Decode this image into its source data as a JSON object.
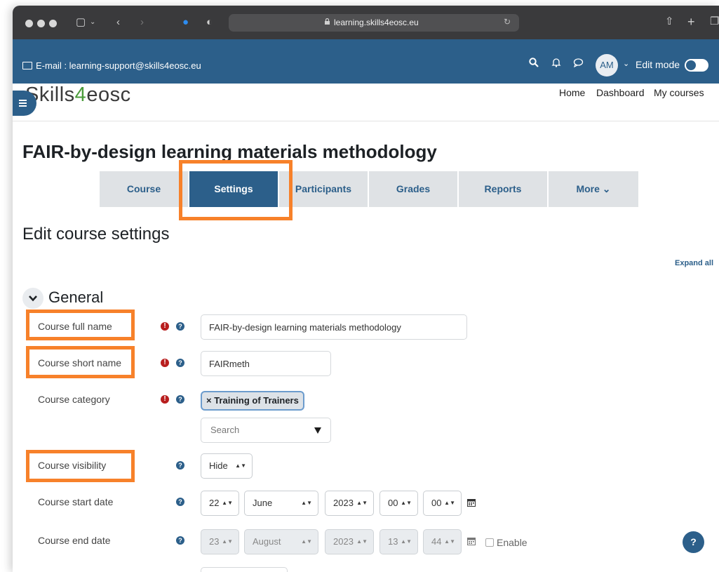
{
  "browser": {
    "url": "learning.skills4eosc.eu"
  },
  "topnav": {
    "email": "E-mail : learning-support@skills4eosc.eu",
    "avatar": "AM",
    "edit_mode": "Edit mode",
    "edit_mode_on": false
  },
  "logo": {
    "part1": "Skills",
    "part2": "4",
    "part3": "eosc"
  },
  "sitenav": {
    "home": "Home",
    "dashboard": "Dashboard",
    "my_courses": "My courses"
  },
  "page": {
    "title": "FAIR-by-design learning materials methodology",
    "section_title": "Edit course settings",
    "expand_all": "Expand all",
    "general": "General"
  },
  "tabs": [
    {
      "label": "Course"
    },
    {
      "label": "Settings",
      "active": true
    },
    {
      "label": "Participants"
    },
    {
      "label": "Grades"
    },
    {
      "label": "Reports"
    },
    {
      "label": "More ⌄"
    }
  ],
  "form": {
    "full_name": {
      "label": "Course full name",
      "value": "FAIR-by-design learning materials methodology"
    },
    "short_name": {
      "label": "Course short name",
      "value": "FAIRmeth"
    },
    "category": {
      "label": "Course category",
      "chip": "× Training of Trainers",
      "search_placeholder": "Search"
    },
    "visibility": {
      "label": "Course visibility",
      "value": "Hide"
    },
    "start_date": {
      "label": "Course start date",
      "day": "22",
      "month": "June",
      "year": "2023",
      "hour": "00",
      "minute": "00"
    },
    "end_date": {
      "label": "Course end date",
      "day": "23",
      "month": "August",
      "year": "2023",
      "hour": "13",
      "minute": "44",
      "enable_label": "Enable"
    }
  },
  "help_fab": "?",
  "colors": {
    "brand_blue": "#2c5f8a",
    "highlight_orange": "#f7812a",
    "required_red": "#b81e1e"
  }
}
